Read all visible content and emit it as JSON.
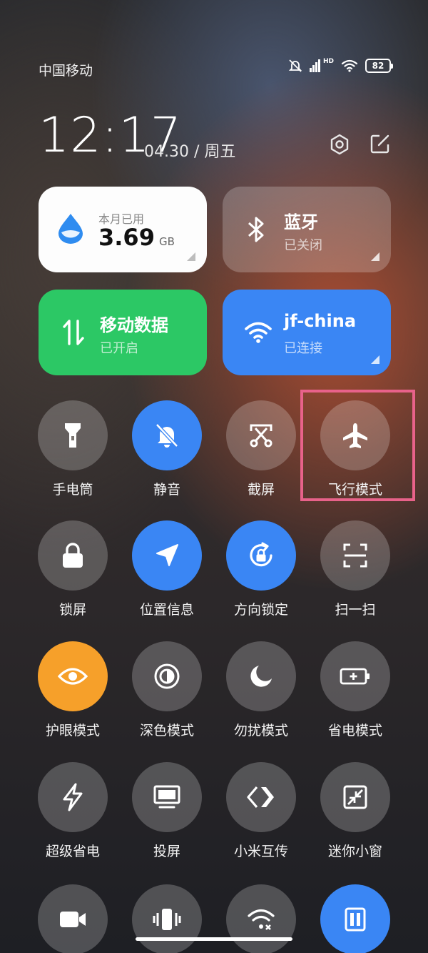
{
  "status": {
    "carrier": "中国移动",
    "hd_label": "HD",
    "battery": "82"
  },
  "header": {
    "time": "12:17",
    "date": "04.30 / 周五"
  },
  "cards": {
    "data_usage": {
      "label": "本月已用",
      "value": "3.69",
      "unit": "GB"
    },
    "bluetooth": {
      "title": "蓝牙",
      "status": "已关闭"
    },
    "mobile_data": {
      "title": "移动数据",
      "status": "已开启"
    },
    "wifi": {
      "title": "jf-china",
      "status": "已连接"
    }
  },
  "toggles": [
    {
      "label": "手电筒",
      "icon": "flashlight-icon",
      "state": "off"
    },
    {
      "label": "静音",
      "icon": "bell-off-icon",
      "state": "on"
    },
    {
      "label": "截屏",
      "icon": "screenshot-icon",
      "state": "off"
    },
    {
      "label": "飞行模式",
      "icon": "airplane-icon",
      "state": "off"
    },
    {
      "label": "锁屏",
      "icon": "lock-icon",
      "state": "off"
    },
    {
      "label": "位置信息",
      "icon": "location-icon",
      "state": "on"
    },
    {
      "label": "方向锁定",
      "icon": "rotation-lock-icon",
      "state": "on"
    },
    {
      "label": "扫一扫",
      "icon": "scan-icon",
      "state": "off"
    },
    {
      "label": "护眼模式",
      "icon": "eye-icon",
      "state": "on"
    },
    {
      "label": "深色模式",
      "icon": "dark-mode-icon",
      "state": "off"
    },
    {
      "label": "勿扰模式",
      "icon": "moon-icon",
      "state": "off"
    },
    {
      "label": "省电模式",
      "icon": "battery-saver-icon",
      "state": "off"
    },
    {
      "label": "超级省电",
      "icon": "lightning-icon",
      "state": "off"
    },
    {
      "label": "投屏",
      "icon": "cast-screen-icon",
      "state": "off"
    },
    {
      "label": "小米互传",
      "icon": "mi-share-icon",
      "state": "off"
    },
    {
      "label": "迷你小窗",
      "icon": "mini-window-icon",
      "state": "off"
    }
  ],
  "colors": {
    "active_blue": "#3a86f4",
    "active_green": "#2cc865",
    "active_orange": "#f6a02a",
    "highlight": "#e8628a"
  }
}
